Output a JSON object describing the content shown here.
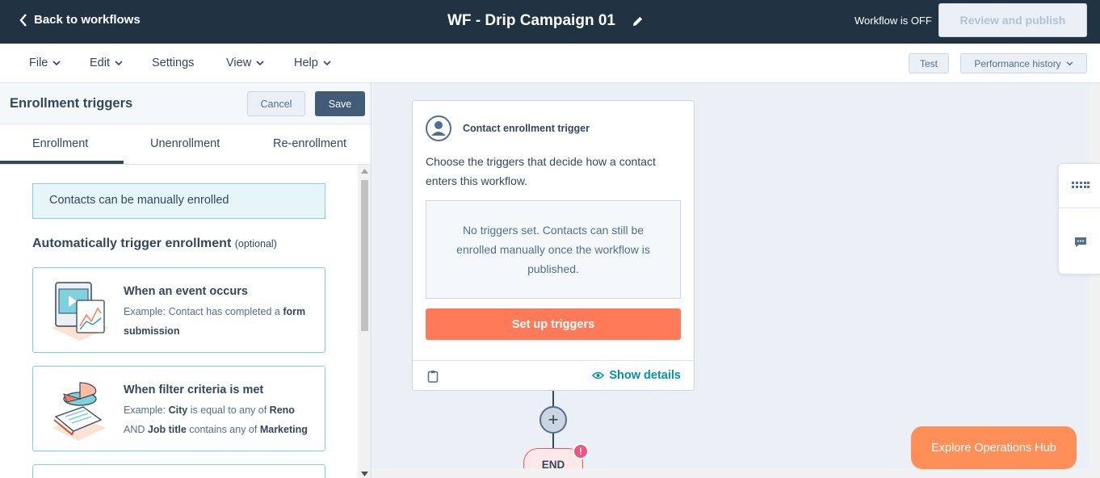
{
  "header": {
    "back_label": "Back to workflows",
    "workflow_title": "WF - Drip Campaign 01",
    "status": "Workflow is OFF",
    "review_label": "Review and publish"
  },
  "menubar": {
    "file": "File",
    "edit": "Edit",
    "settings": "Settings",
    "view": "View",
    "help": "Help",
    "test": "Test",
    "performance": "Performance history"
  },
  "panel": {
    "title": "Enrollment triggers",
    "cancel": "Cancel",
    "save": "Save",
    "tabs": [
      "Enrollment",
      "Unenrollment",
      "Re-enrollment"
    ],
    "manual_note": "Contacts can be manually enrolled",
    "auto_heading": "Automatically trigger enrollment",
    "auto_optional": "(optional)",
    "cards": [
      {
        "title": "When an event occurs",
        "desc_pre": "Example: Contact has completed a ",
        "desc_bold": "form submission"
      },
      {
        "title": "When filter criteria is met",
        "ex_label": "Example: ",
        "city": "City",
        "mid1": " is equal to any of ",
        "reno": "Reno",
        "and": "AND ",
        "jobtitle": "Job title",
        "mid2": " contains any of ",
        "marketing": "Marketing"
      }
    ]
  },
  "canvas": {
    "node_title": "Contact enrollment trigger",
    "node_desc": "Choose the triggers that decide how a contact enters this workflow.",
    "empty_text": "No triggers set. Contacts can still be enrolled manually once the workflow is published.",
    "setup_label": "Set up triggers",
    "show_details": "Show details",
    "plus": "+",
    "end_label": "END",
    "alert": "!",
    "explore_label": "Explore Operations Hub"
  },
  "colors": {
    "header_bg": "#213343",
    "accent_orange": "#ff7a59",
    "link_teal": "#0091ae",
    "canvas_bg": "#eaf0f6"
  }
}
